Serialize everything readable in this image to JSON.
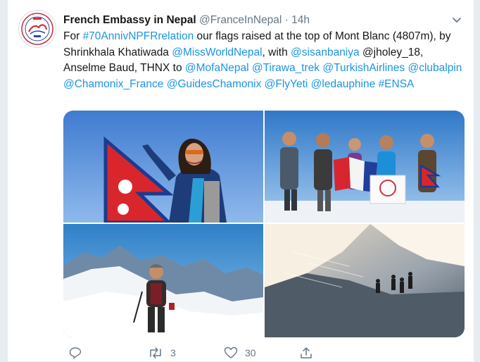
{
  "tweet": {
    "author_name": "French Embassy in Nepal",
    "author_handle": "@FranceInNepal",
    "separator": "·",
    "timestamp": "14h",
    "text": {
      "t1": "For ",
      "hashtag1": "#70AnnivNPFRrelation",
      "t2": " our flags raised at the top of Mont Blanc (4807m), by Shrinkhala Khatiwada ",
      "m1": "@MissWorldNepal",
      "t3": ", with ",
      "m2": "@sisanbaniya",
      "t4": " @jholey_18, Anselme Baud, THNX to ",
      "m3": "@MofaNepal",
      "t5": " ",
      "m4": "@Tirawa_trek",
      "t6": " ",
      "m5": "@TurkishAirlines",
      "t7": " ",
      "m6": "@clubalpin",
      "t8": " ",
      "m7": "@Chamonix_France",
      "t9": " ",
      "m8": "@GuidesChamonix",
      "t10": " ",
      "m9": "@FlyYeti",
      "t11": " ",
      "m10": "@ledauphine",
      "t12": " ",
      "hashtag2": "#ENSA"
    },
    "actions": {
      "reply_count": "",
      "retweet_count": "3",
      "like_count": "30"
    }
  },
  "colors": {
    "link": "#1b95e0",
    "secondary_text": "#657786",
    "background": "#e6ecf0"
  },
  "icons": [
    "avatar-logo",
    "chevron-down-icon",
    "reply-icon",
    "retweet-icon",
    "like-icon",
    "share-icon"
  ]
}
